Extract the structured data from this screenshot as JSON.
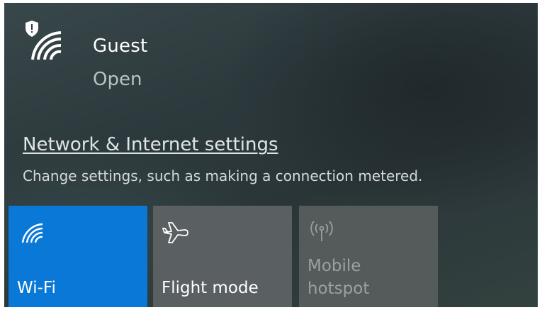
{
  "network": {
    "name": "Guest",
    "status": "Open",
    "icon": "wifi-secured-icon"
  },
  "settings": {
    "link_label": "Network & Internet settings",
    "description": "Change settings, such as making a connection metered."
  },
  "quick_actions": [
    {
      "label": "Wi-Fi",
      "icon": "wifi-icon",
      "state": "on",
      "color": "#0a78d7"
    },
    {
      "label": "Flight mode",
      "icon": "airplane-icon",
      "state": "off",
      "color": "#5a5f61"
    },
    {
      "label_line1": "Mobile",
      "label_line2": "hotspot",
      "icon": "mobile-hotspot-icon",
      "state": "disabled",
      "color": "#555a5b"
    }
  ]
}
